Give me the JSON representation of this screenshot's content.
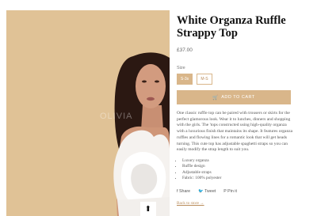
{
  "product": {
    "title": "White Organza Ruffle Strappy Top",
    "price": "£37.00",
    "size_label": "Size",
    "sizes": [
      "S-3s",
      "M-S"
    ],
    "add_to_cart": "ADD TO CART",
    "description": "One classic ruffle top can be paired with trousers or skirts for the perfect glamorous look. Wear it to lunches, dinners and shopping with the girls. The 'tops constructed using high-quality organza with a luxurious finish that maintains its shape. It features organza ruffles and flowing lines for a romantic look that will get heads turning. This cute top has adjustable spaghetti straps so you can easily modify the strap length to suit you.",
    "features": [
      "Luxury organza",
      "Ruffle design",
      "Adjustable straps",
      "Fabric: 100% polyester"
    ]
  },
  "share": {
    "facebook": "Share",
    "twitter": "Tweet",
    "pinterest": "Pin it"
  },
  "back_link": "Back to store →",
  "zoom_icon": "arrow-up-icon",
  "watermark": "OLIVIA"
}
